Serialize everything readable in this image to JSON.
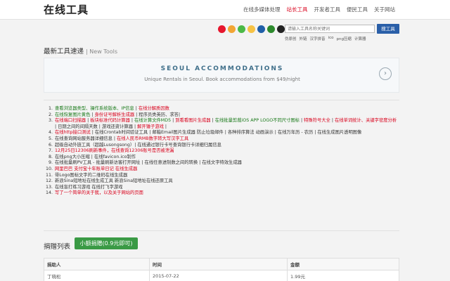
{
  "header": {
    "logo": "在线工具",
    "nav": [
      "在线多媒体处理",
      "站长工具",
      "开发者工具",
      "便民工具",
      "关于网站"
    ],
    "active_index": 1
  },
  "social_icons": [
    "weibo-icon",
    "tencent-weibo-icon",
    "wechat-icon",
    "qzone-icon",
    "renren-icon",
    "douban-icon",
    "qq-icon",
    "baidu-icon",
    "kaixin-icon"
  ],
  "search": {
    "placeholder": "请输入工具名称关键词",
    "button": "搜工具"
  },
  "hot_words": [
    "伪原创",
    "外链",
    "汉字拼音",
    "ico",
    "png压缩",
    "计算器"
  ],
  "latest": {
    "title": "最新工具速递",
    "subtitle": "New Tools"
  },
  "ad": {
    "title": "SEOUL ACCOMMODATIONS",
    "subtitle": "Unique Rentals in Seoul. Book accommodations from $49/night",
    "arrow": "›"
  },
  "tools": [
    {
      "n": "1.",
      "segments": [
        {
          "t": "查看浏览器类型、操作系统版本、IP信息",
          "c": "green"
        },
        {
          "t": " | ",
          "c": "dark"
        },
        {
          "t": "在线分解质因数",
          "c": "red"
        }
      ]
    },
    {
      "n": "2.",
      "segments": [
        {
          "t": "在线恢复图片黄色",
          "c": "green"
        },
        {
          "t": " | ",
          "c": "dark"
        },
        {
          "t": "身份证号解析生成器",
          "c": "red"
        },
        {
          "t": " | 程序员类英历、求答|",
          "c": "dark"
        }
      ]
    },
    {
      "n": "3.",
      "segments": [
        {
          "t": "在线端口扫描器",
          "c": "red"
        },
        {
          "t": " | ",
          "c": "dark"
        },
        {
          "t": "板块标准代码计算器",
          "c": "red"
        },
        {
          "t": " | ",
          "c": "dark"
        },
        {
          "t": "在线计算文件MD5",
          "c": "green"
        },
        {
          "t": " | ",
          "c": "dark"
        },
        {
          "t": "到看看图片生成器",
          "c": "red"
        },
        {
          "t": " | ",
          "c": "dark"
        },
        {
          "t": "在线批量剪裁iOS APP LOGO不同尺寸图标",
          "c": "green"
        },
        {
          "t": " | ",
          "c": "dark"
        },
        {
          "t": "特殊符号大全",
          "c": "red"
        },
        {
          "t": " | ",
          "c": "dark"
        },
        {
          "t": "在线单词统计、关键字密度分析",
          "c": "red"
        },
        {
          "t": " | 日期之间的间隔天数 | 游戏还资计算器 | ",
          "c": "dark"
        },
        {
          "t": "解开锤子游戏",
          "c": "red"
        },
        {
          "t": " |",
          "c": "dark"
        }
      ]
    },
    {
      "n": "4.",
      "segments": [
        {
          "t": "在线http接口测试",
          "c": "red"
        },
        {
          "t": " | 在线Crontab时间验证工具 | 邮箱Email图片生成器 防止垃圾邮件 | 各种排序算法 动画演示 | 在线万年历 - 农历 | 在线生成图片透明图像",
          "c": "dark"
        }
      ]
    },
    {
      "n": "5.",
      "segments": [
        {
          "t": "在线查询网站服务器详细信息",
          "c": "dark"
        },
        {
          "t": " | ",
          "c": "dark"
        },
        {
          "t": "在线人民币RMB数字转大写汉字工具",
          "c": "red"
        }
      ]
    },
    {
      "n": "6.",
      "segments": [
        {
          "t": "超级自动外链工具（超越Lusongsong）| 在线通过银行卡号查询银行卡详细归属信息",
          "c": "dark"
        }
      ]
    },
    {
      "n": "7.",
      "segments": [
        {
          "t": "12月25日12306刷新事件，在线查询12306账号是否被泄漏",
          "c": "red"
        }
      ]
    },
    {
      "n": "8.",
      "segments": [
        {
          "t": "在线png大小压缩 | 在线favicon.ico制作",
          "c": "dark"
        }
      ]
    },
    {
      "n": "9.",
      "segments": [
        {
          "t": "在线批量刷PV工具 - 批量刷新访客打开网址 | 在线任意进制数之间的转换 | 在线文字特效生成器",
          "c": "dark"
        }
      ]
    },
    {
      "n": "10.",
      "segments": [
        {
          "t": "网里巴巴 支付宝十年账单日记 在线生成器",
          "c": "red"
        }
      ]
    },
    {
      "n": "11.",
      "segments": [
        {
          "t": "带Logo图标文字的二维码在线生成器",
          "c": "dark"
        }
      ]
    },
    {
      "n": "12.",
      "segments": [
        {
          "t": "新浪Sina短地址在线生成工具 新浪Sina短地址在线还原工具",
          "c": "dark"
        }
      ]
    },
    {
      "n": "13.",
      "segments": [
        {
          "t": "在线盲打练习游戏 在线打飞字游戏",
          "c": "dark"
        }
      ]
    },
    {
      "n": "14.",
      "segments": [
        {
          "t": "写了一个简单的关于我，以及关于网站的页面",
          "c": "red"
        }
      ]
    }
  ],
  "donate": {
    "title": "捐赠列表",
    "button": "小额捐赠(0.9元即可)",
    "headers": [
      "捐助人",
      "时间",
      "金额"
    ],
    "rows": [
      [
        "丁晓松",
        "2015-07-22",
        "1.99元"
      ]
    ]
  },
  "colors": {
    "accent_red": "#d9001b",
    "green": "#1a7a1a",
    "button_blue": "#2a5fa8",
    "donate_green": "#3a9a45"
  }
}
